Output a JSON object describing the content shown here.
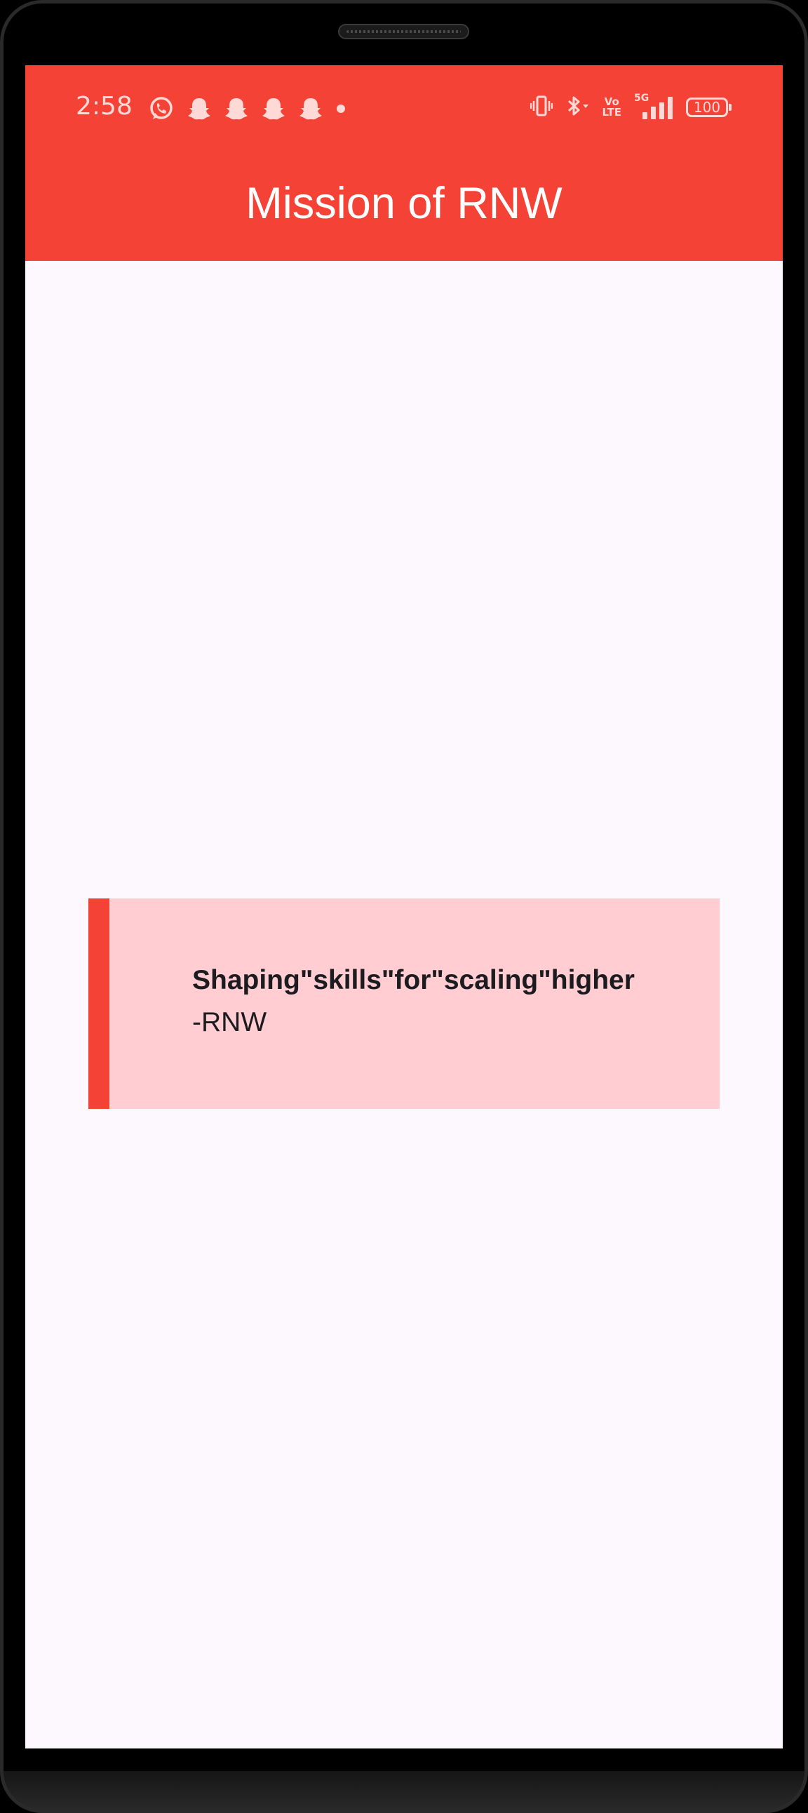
{
  "status_bar": {
    "time": "2:58",
    "notification_icons": [
      "whatsapp-icon",
      "snapchat-icon",
      "snapchat-icon",
      "snapchat-icon",
      "snapchat-icon",
      "more-dot-icon"
    ],
    "volte_top": "Vo",
    "volte_bottom": "LTE",
    "network_type": "5G",
    "battery": "100"
  },
  "app_bar": {
    "title": "Mission of RNW"
  },
  "quote": {
    "text": "Shaping\"skills\"for\"scaling\"higher",
    "author": "-RNW"
  },
  "colors": {
    "primary": "#f44336",
    "card_background": "#ffcdd2",
    "screen_background": "#fdf7fe",
    "text": "#1c1b1f"
  }
}
